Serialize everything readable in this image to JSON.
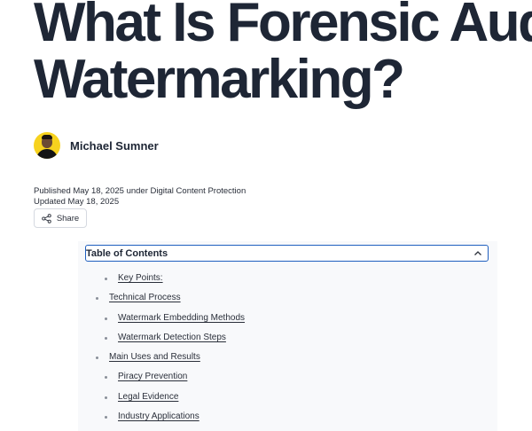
{
  "article": {
    "title_line1": "What Is Forensic Audio",
    "title_line2": "Watermarking?",
    "author": {
      "name": "Michael Sumner"
    },
    "published": "Published May 18, 2025 under Digital Content Protection",
    "updated": "Updated May 18, 2025",
    "share_label": "Share"
  },
  "toc": {
    "title": "Table of Contents",
    "items": [
      {
        "label": "Key Points:",
        "level": 2
      },
      {
        "label": "Technical Process",
        "level": 1
      },
      {
        "label": "Watermark Embedding Methods",
        "level": 2
      },
      {
        "label": "Watermark Detection Steps",
        "level": 2
      },
      {
        "label": "Main Uses and Results",
        "level": 1
      },
      {
        "label": "Piracy Prevention",
        "level": 2
      },
      {
        "label": "Legal Evidence",
        "level": 2
      },
      {
        "label": "Industry Applications",
        "level": 2
      }
    ]
  },
  "icons": {
    "share": "share-icon",
    "chevron": "chevron-up-icon",
    "avatar": "avatar"
  },
  "colors": {
    "title": "#1e2635",
    "focus_outline": "#1f5fbf",
    "avatar_bg": "#f7d21e",
    "toc_bg": "#f8f9fb"
  }
}
